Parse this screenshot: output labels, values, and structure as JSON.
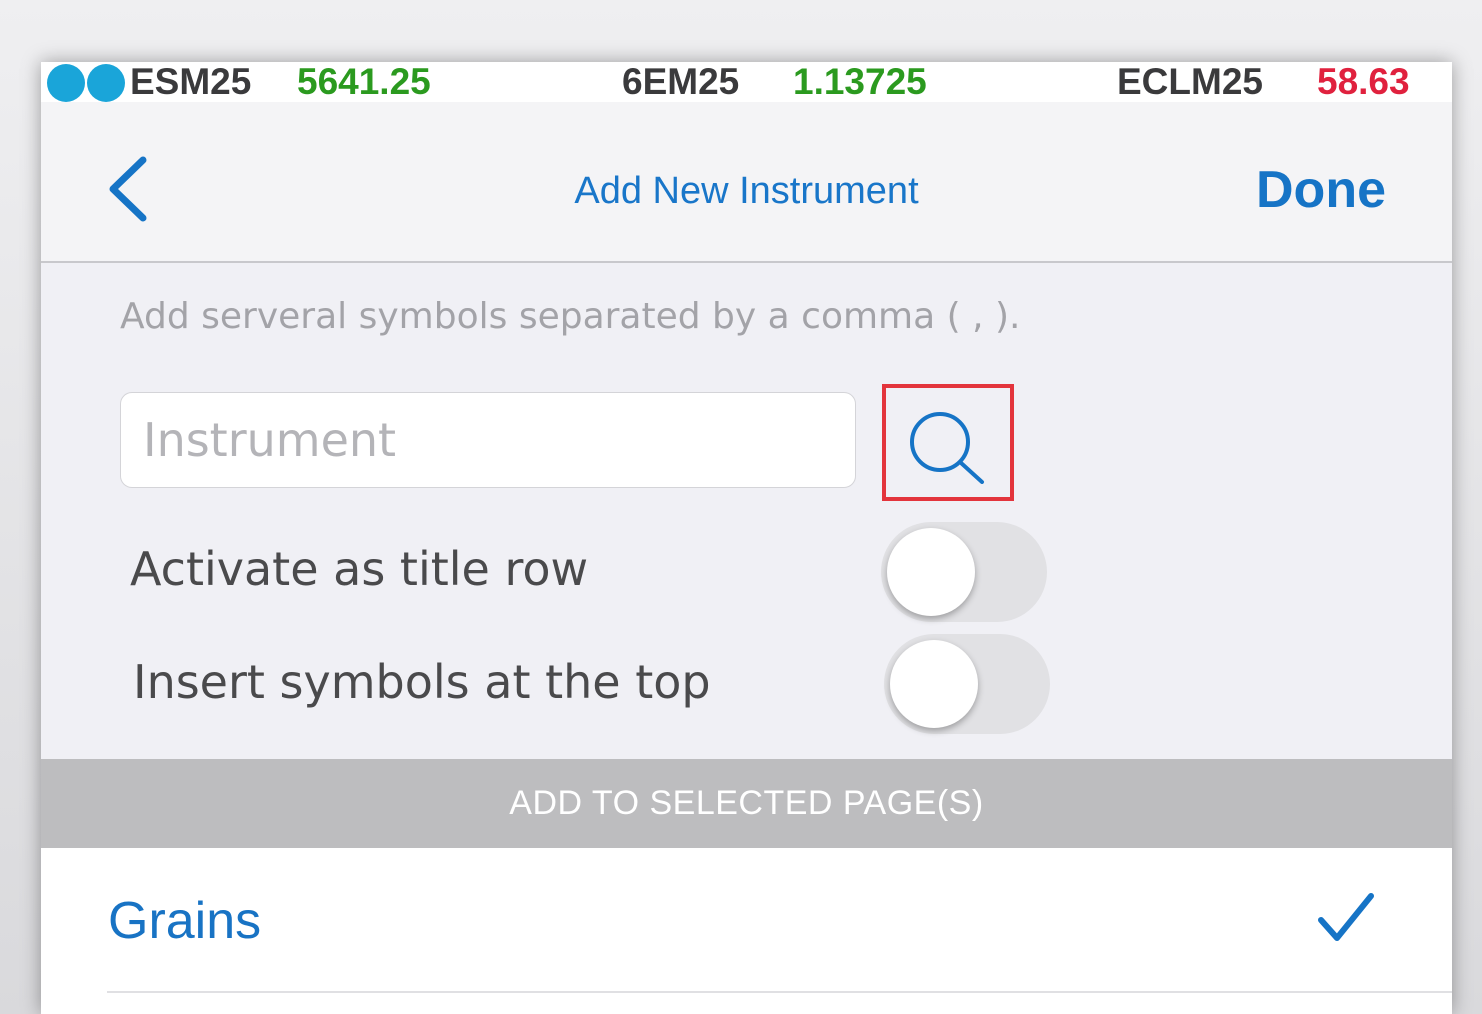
{
  "ticker": [
    {
      "symbol": "ESM25",
      "price": "5641.25",
      "direction": "up"
    },
    {
      "symbol": "6EM25",
      "price": "1.13725",
      "direction": "up"
    },
    {
      "symbol": "ECLM25",
      "price": "58.63",
      "direction": "down"
    }
  ],
  "colors": {
    "accent": "#1674c6",
    "up": "#2b9a1f",
    "down": "#e0213e",
    "status_dot": "#1aa5d9",
    "highlight_box": "#e3343c"
  },
  "nav": {
    "back_icon": "chevron-left-icon",
    "title": "Add New Instrument",
    "done_label": "Done"
  },
  "form": {
    "hint": "Add serveral symbols separated by a comma ( , ).",
    "instrument_placeholder": "Instrument",
    "instrument_value": "",
    "search_icon": "search-icon",
    "toggles": [
      {
        "label": "Activate as title row",
        "on": false
      },
      {
        "label": "Insert symbols at the top",
        "on": false
      }
    ]
  },
  "pages_section": {
    "header": "ADD TO SELECTED PAGE(S)",
    "items": [
      {
        "label": "Grains",
        "selected": true,
        "check_icon": "checkmark-icon"
      }
    ]
  }
}
